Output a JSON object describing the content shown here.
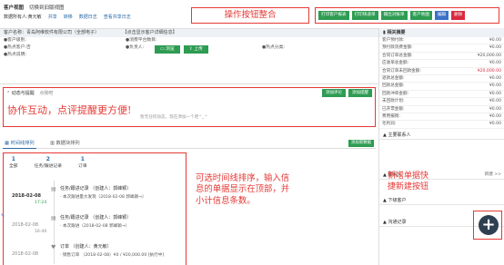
{
  "header": {
    "title": "客户视图",
    "switch": "切换到旧版视图",
    "owner": "数据所有人:黄元敏",
    "share": "共享",
    "transfer": "转移",
    "log": "数据日志",
    "timeline_log": "查看共享日志"
  },
  "annotations": {
    "top": "操作按钮整合",
    "dyn": "协作互动，点评提醒更方便!",
    "mid_lines": [
      "可选时间线排序，输入信",
      "息的单据显示在顶部，并",
      "小计信息条数。"
    ],
    "right_lines": [
      "新增单据快",
      "捷新建按钮"
    ]
  },
  "toolbar": {
    "buttons": [
      {
        "label": "打印客户报表",
        "color": "green"
      },
      {
        "label": "打印快递单",
        "color": "green"
      },
      {
        "label": "输出对账单",
        "color": "green"
      },
      {
        "label": "客户地图",
        "color": "green"
      },
      {
        "label": "编辑",
        "color": "blue"
      },
      {
        "label": "删除",
        "color": "red"
      }
    ]
  },
  "info": {
    "name_label": "客户名称：青岛阿维软件有限公司（全部电子）",
    "crm_label": "【点击显示客户详细信息】",
    "rows": [
      [
        "●客户级别:",
        "●消费平台数目:",
        ""
      ],
      [
        "●热点客户:否",
        "●负责人:",
        "●热点分类:"
      ],
      [
        "●热点说明:",
        "",
        ""
      ]
    ],
    "btn_browse": "浏览",
    "btn_upload": "上传"
  },
  "dynamic": {
    "title": "动态与提醒",
    "sub": "点我吧",
    "btn_comment": "添加评论",
    "btn_remind": "添加提醒",
    "placeholder": "暂无任何动态，现在添加一个吧^_^"
  },
  "tabs": {
    "active": "时间线排列",
    "other": "数据块排列",
    "add": "添加新数据"
  },
  "stats": [
    {
      "num": "1",
      "label": "全部"
    },
    {
      "num": "2",
      "label": "任务/跟进记录"
    },
    {
      "num": "1",
      "label": "订单"
    }
  ],
  "timeline": [
    {
      "date": "2018-02-08",
      "time": "17:24",
      "timeGreen": true,
      "title": "任务/跟进记录 （创建人：郭峰颖）",
      "sub": "· 本次跟进量大发现（2018-02-08 郭峰颖→）"
    },
    {
      "date": "2018-02-08",
      "time": "16:40",
      "timeGreen": false,
      "title": "任务/跟进记录 （创建人：郭峰颖）",
      "sub": "· 本次跟进（2018-02-08 郭峰颖→）"
    },
    {
      "date": "2018-02-08",
      "time": "",
      "timeGreen": false,
      "title": "订单 （创建人：黄元敏）",
      "sub": "· 销售订单 （2018-02-08）¥0 / ¥20,000.00 [执行中]"
    }
  ],
  "side": {
    "title": "相关摘要",
    "rows": [
      {
        "k": "客户预付款:",
        "v": "¥0.00",
        "red": false
      },
      {
        "k": "预付款消费金额:",
        "v": "¥0.00",
        "red": false
      },
      {
        "k": "合同订单总金额:",
        "v": "¥20,000.00",
        "red": false
      },
      {
        "k": "应收单总金额:",
        "v": "¥0.00",
        "red": false
      },
      {
        "k": "合同订单未回款金额:",
        "v": "¥20,000.00",
        "red": true
      },
      {
        "k": "退款总金额:",
        "v": "¥0.00",
        "red": false
      },
      {
        "k": "回款总金额:",
        "v": "¥0.00",
        "red": false
      },
      {
        "k": "回款冲单金额:",
        "v": "¥0.00",
        "red": false
      },
      {
        "k": "未回款计划:",
        "v": "¥0.00",
        "red": false
      },
      {
        "k": "已开票金额:",
        "v": "¥0.00",
        "red": false
      },
      {
        "k": "费用报销:",
        "v": "¥0.00",
        "red": false
      },
      {
        "k": "毛利润:",
        "v": "¥0.00",
        "red": false
      }
    ],
    "main_contact": "主要联系人",
    "contacts": "联系人",
    "contacts_new": "新建 >>",
    "sub_customer": "下级客户",
    "comms": "沟通记录"
  }
}
